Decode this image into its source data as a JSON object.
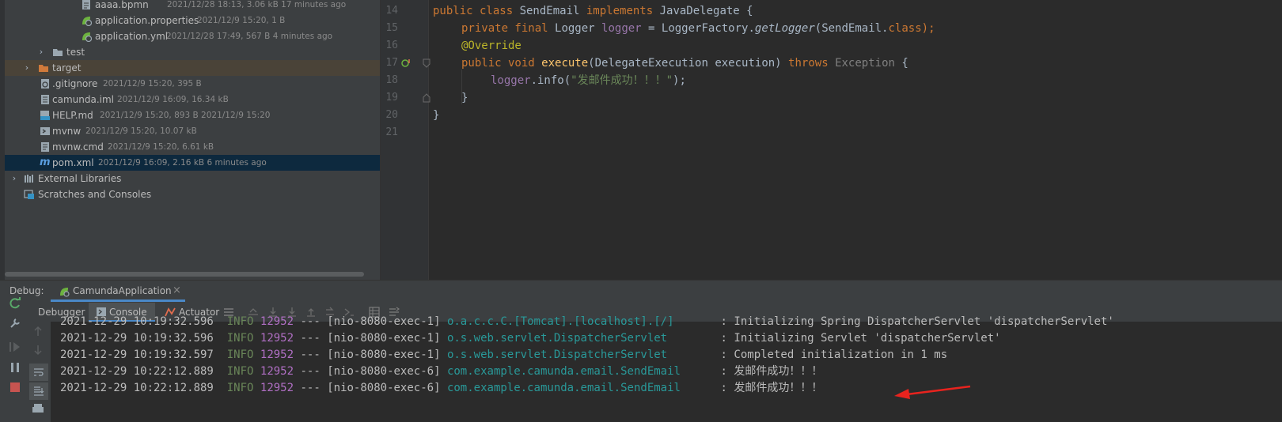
{
  "project_tree": {
    "rows": [
      {
        "name": "aaaa.bpmn",
        "meta": "2021/12/28 18:13, 3.06 kB 17 minutes ago",
        "icon": "bpmn-file-icon"
      },
      {
        "name": "application.properties",
        "meta": "2021/12/9 15:20, 1 B",
        "icon": "spring-config-icon"
      },
      {
        "name": "application.yml",
        "meta": "2021/12/28 17:49, 567 B 4 minutes ago",
        "icon": "spring-config-icon"
      },
      {
        "name": "test",
        "meta": "",
        "icon": "folder-icon"
      },
      {
        "name": "target",
        "meta": "",
        "icon": "folder-orange-icon"
      },
      {
        "name": ".gitignore",
        "meta": "2021/12/9 15:20, 395 B",
        "icon": "gitignore-icon"
      },
      {
        "name": "camunda.iml",
        "meta": "2021/12/9 16:09, 16.34 kB",
        "icon": "iml-file-icon"
      },
      {
        "name": "HELP.md",
        "meta": "2021/12/9 15:20, 893 B 2021/12/9 15:20",
        "icon": "markdown-icon"
      },
      {
        "name": "mvnw",
        "meta": "2021/12/9 15:20, 10.07 kB",
        "icon": "shell-icon"
      },
      {
        "name": "mvnw.cmd",
        "meta": "2021/12/9 15:20, 6.61 kB",
        "icon": "text-file-icon"
      },
      {
        "name": "pom.xml",
        "meta": "2021/12/9 16:09, 2.16 kB 6 minutes ago",
        "icon": "maven-icon"
      },
      {
        "name": "External Libraries",
        "meta": "",
        "icon": "libraries-icon"
      },
      {
        "name": "Scratches and Consoles",
        "meta": "",
        "icon": "scratches-icon"
      }
    ]
  },
  "editor": {
    "line_numbers": [
      "14",
      "15",
      "16",
      "17",
      "18",
      "19",
      "20",
      "21"
    ],
    "l14": {
      "a": "public class ",
      "b": "SendEmail ",
      "c": "implements ",
      "d": "JavaDelegate {"
    },
    "l15": {
      "a": "private final ",
      "b": "Logger ",
      "c": "logger",
      "d": " = LoggerFactory.",
      "e": "getLogger",
      "f": "(SendEmail.",
      "g": "class",
      "h": ");"
    },
    "l16": {
      "a": "@Override"
    },
    "l17": {
      "a": "public void ",
      "b": "execute",
      "c": "(DelegateExecution execution) ",
      "d": "throws ",
      "e": "Exception",
      "f": " {"
    },
    "l18": {
      "a": "logger",
      "b": ".info(",
      "c": "\"发邮件成功！！！\"",
      "d": ");"
    },
    "l19": {
      "a": "}"
    },
    "l20": {
      "a": "}"
    }
  },
  "debug": {
    "label": "Debug:",
    "run_config": "CamundaApplication",
    "close": "×",
    "tabs": {
      "debugger": "Debugger",
      "console": "Console",
      "actuator": "Actuator"
    }
  },
  "console": {
    "lines": [
      {
        "ts": "2021-12-29 10:19:32.596",
        "level": "INFO",
        "pid": "12952",
        "sep": "---",
        "thread": "[nio-8080-exec-1]",
        "logger": "o.a.c.c.C.[Tomcat].[localhost].[/]      ",
        "msg": ": Initializing Spring DispatcherServlet 'dispatcherServlet'"
      },
      {
        "ts": "2021-12-29 10:19:32.596",
        "level": "INFO",
        "pid": "12952",
        "sep": "---",
        "thread": "[nio-8080-exec-1]",
        "logger": "o.s.web.servlet.DispatcherServlet       ",
        "msg": ": Initializing Servlet 'dispatcherServlet'"
      },
      {
        "ts": "2021-12-29 10:19:32.597",
        "level": "INFO",
        "pid": "12952",
        "sep": "---",
        "thread": "[nio-8080-exec-1]",
        "logger": "o.s.web.servlet.DispatcherServlet       ",
        "msg": ": Completed initialization in 1 ms"
      },
      {
        "ts": "2021-12-29 10:22:12.889",
        "level": "INFO",
        "pid": "12952",
        "sep": "---",
        "thread": "[nio-8080-exec-6]",
        "logger": "com.example.camunda.email.SendEmail     ",
        "msg": ": 发邮件成功！！！"
      },
      {
        "ts": "2021-12-29 10:22:12.889",
        "level": "INFO",
        "pid": "12952",
        "sep": "---",
        "thread": "[nio-8080-exec-6]",
        "logger": "com.example.camunda.email.SendEmail     ",
        "msg": ": 发邮件成功！！！"
      }
    ]
  },
  "colors": {
    "annotation_arrow": "#e8231e",
    "selection": "#0d293e",
    "console_class": "#299999"
  }
}
